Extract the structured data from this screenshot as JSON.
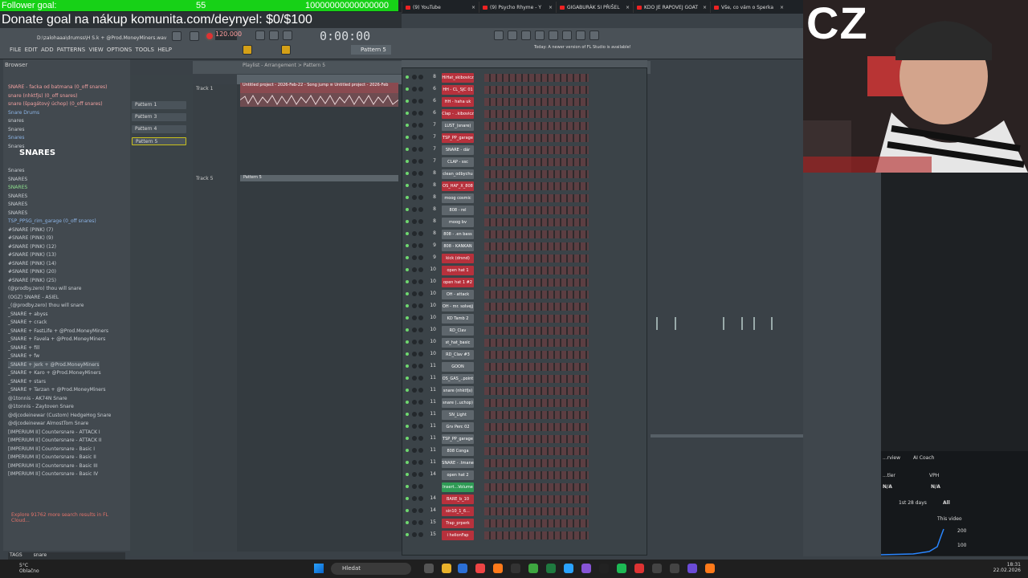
{
  "stream": {
    "follower_goal": "Follower goal:",
    "follower_count": "55",
    "follower_target": "10000000000000000",
    "donate": "Donate goal na nákup komunita.com/deynyel: $0/$100",
    "logo": "CZ"
  },
  "browser_tabs": [
    {
      "title": "(9) YouTube"
    },
    {
      "title": "(9) Psycho Rhyme - Y"
    },
    {
      "title": "GIGABURÁK SI PŘIŠEL"
    },
    {
      "title": "KDO JE RAPOVEJ GOAT"
    },
    {
      "title": "Vše, co vám o Sperka"
    }
  ],
  "daw": {
    "path": "D:\\zalohaaa\\drumss\\H S.k + @Prod.MoneyMiners.wav",
    "menu": "FILE EDIT ADD PATTERNS VIEW OPTIONS TOOLS HELP",
    "tempo": "120.000",
    "time": "0:00:00",
    "pattern_selector": "Pattern 5",
    "news": "Today: A newer version of FL Studio is available!",
    "playlist_title": "Playlist - Arrangement > Pattern 5",
    "browser_title": "Browser",
    "browser_items": [
      {
        "label": "SNARE - facka od batmana  (0_off snares)",
        "style": "red"
      },
      {
        "label": "snare (nhktfjs)  (0_off snares)",
        "style": "red"
      },
      {
        "label": "snare (špagátový úchop)  (0_off snares)",
        "style": "red"
      },
      {
        "label": "Snare Drums",
        "style": "blu"
      },
      {
        "label": "snares",
        "style": ""
      },
      {
        "label": "Snares",
        "style": ""
      },
      {
        "label": "Snares",
        "style": "blu"
      },
      {
        "label": "Snares",
        "style": ""
      },
      {
        "label": "Snares",
        "style": ""
      },
      {
        "label": "SNARES",
        "style": ""
      },
      {
        "label": "SNARES",
        "style": "grn"
      },
      {
        "label": "SNARES",
        "style": ""
      },
      {
        "label": "SNARES",
        "style": ""
      },
      {
        "label": "SNARES",
        "style": ""
      },
      {
        "label": "TSP_PPSG_rim_garage  (0_off snares)",
        "style": "blu"
      },
      {
        "label": "#SNARE (PINK) (7)",
        "style": ""
      },
      {
        "label": "#SNARE (PINK) (9)",
        "style": ""
      },
      {
        "label": "#SNARE (PINK) (12)",
        "style": ""
      },
      {
        "label": "#SNARE (PINK) (13)",
        "style": ""
      },
      {
        "label": "#SNARE (PINK) (14)",
        "style": ""
      },
      {
        "label": "#SNARE (PINK) (20)",
        "style": ""
      },
      {
        "label": "#SNARE (PINK) (25)",
        "style": ""
      },
      {
        "label": "(@prodby.zero) thou will snare",
        "style": ""
      },
      {
        "label": "(OGZ) SNARE - ASIEL",
        "style": ""
      },
      {
        "label": "_(@prodby.zero) thou will snare",
        "style": ""
      },
      {
        "label": "_SNARE + abyss",
        "style": ""
      },
      {
        "label": "_SNARE + crack",
        "style": ""
      },
      {
        "label": "_SNARE + FastLife + @Prod.MoneyMiners",
        "style": ""
      },
      {
        "label": "_SNARE + Favela + @Prod.MoneyMiners",
        "style": ""
      },
      {
        "label": "_SNARE + fill",
        "style": ""
      },
      {
        "label": "_SNARE + fw",
        "style": ""
      },
      {
        "label": "_SNARE + Jerk + @Prod.MoneyMiners",
        "style": "sel"
      },
      {
        "label": "_SNARE + Karo + @Prod.MoneyMiners",
        "style": ""
      },
      {
        "label": "_SNARE + stars",
        "style": ""
      },
      {
        "label": "_SNARE + Tarzan + @Prod.MoneyMiners",
        "style": ""
      },
      {
        "label": "@1tonnis - AK74N Snare",
        "style": ""
      },
      {
        "label": "@1tonnis - Zaytoven Snare",
        "style": ""
      },
      {
        "label": "@djcodeinewar (Custom) HedgeHog Snare",
        "style": ""
      },
      {
        "label": "@djcodeinewar AlmostTom Snare",
        "style": ""
      },
      {
        "label": "[IMPERIUM II] Countersnare - ATTACK I",
        "style": ""
      },
      {
        "label": "[IMPERIUM II] Countersnare - ATTACK II",
        "style": ""
      },
      {
        "label": "[IMPERIUM II] Countersnare - Basic I",
        "style": ""
      },
      {
        "label": "[IMPERIUM II] Countersnare - Basic II",
        "style": ""
      },
      {
        "label": "[IMPERIUM II] Countersnare - Basic III",
        "style": ""
      },
      {
        "label": "[IMPERIUM II] Countersnare - Basic IV",
        "style": ""
      }
    ],
    "snares_heading": "SNARES",
    "explore": "Explore 91762 more search results in FL Cloud...",
    "search_tag": "TAGS",
    "search_value": "snare",
    "patterns": [
      "Pattern 1",
      "Pattern 3",
      "Pattern 4",
      "Pattern 5"
    ],
    "tracks": [
      "Track 1",
      "Track 5"
    ],
    "clip_title": "Untitled project - 2026-Feb-22 - Song jump  ≡ Untitled project - 2026-Feb",
    "clip2_title": "Pattern 5",
    "channels": [
      {
        "mix": "8",
        "name": "HiHat_skibovicz",
        "color": "r"
      },
      {
        "mix": "6",
        "name": "HH - CL_SJC 01",
        "color": "r"
      },
      {
        "mix": "6",
        "name": "HH - haha uk",
        "color": "r"
      },
      {
        "mix": "6",
        "name": "Clap - ..kibovicz",
        "color": "r"
      },
      {
        "mix": "7",
        "name": "LUST_(snare)",
        "color": ""
      },
      {
        "mix": "7",
        "name": "TSP_PP_garage",
        "color": "r"
      },
      {
        "mix": "7",
        "name": "SNARE - dár",
        "color": ""
      },
      {
        "mix": "7",
        "name": "CLAP - ssc",
        "color": ""
      },
      {
        "mix": "8",
        "name": "clean_odbychu",
        "color": ""
      },
      {
        "mix": "8",
        "name": "OS_HAF_X_808",
        "color": "r"
      },
      {
        "mix": "8",
        "name": "moog cosmic",
        "color": ""
      },
      {
        "mix": "8",
        "name": "808 - rel",
        "color": ""
      },
      {
        "mix": "8",
        "name": "moog bv",
        "color": ""
      },
      {
        "mix": "8",
        "name": "808 - .en bass",
        "color": ""
      },
      {
        "mix": "9",
        "name": "808 - KANKAN",
        "color": ""
      },
      {
        "mix": "9",
        "name": "kick (drsnd)",
        "color": "r"
      },
      {
        "mix": "10",
        "name": "open hat 1",
        "color": "r"
      },
      {
        "mix": "10",
        "name": "open hat 1 #2",
        "color": "r"
      },
      {
        "mix": "10",
        "name": "OH - attack",
        "color": ""
      },
      {
        "mix": "10",
        "name": "OH - mr. solvejj",
        "color": ""
      },
      {
        "mix": "10",
        "name": "KD Tamb 2",
        "color": ""
      },
      {
        "mix": "10",
        "name": "RD_Clav",
        "color": ""
      },
      {
        "mix": "10",
        "name": "st_hat_basic",
        "color": ""
      },
      {
        "mix": "10",
        "name": "RD_Clav #3",
        "color": ""
      },
      {
        "mix": "11",
        "name": "GOON",
        "color": ""
      },
      {
        "mix": "11",
        "name": "OS_GAS_..point",
        "color": ""
      },
      {
        "mix": "11",
        "name": "snare (nhktfjs)",
        "color": ""
      },
      {
        "mix": "11",
        "name": "snare (..uchop)",
        "color": ""
      },
      {
        "mix": "11",
        "name": "SN_Light",
        "color": ""
      },
      {
        "mix": "11",
        "name": "Grv Perc 02",
        "color": ""
      },
      {
        "mix": "11",
        "name": "TSP_PP_garage",
        "color": ""
      },
      {
        "mix": "11",
        "name": "808 Conga",
        "color": ""
      },
      {
        "mix": "11",
        "name": "SNARE - .tmane",
        "color": ""
      },
      {
        "mix": "14",
        "name": "open hat 2",
        "color": ""
      },
      {
        "mix": "",
        "name": "Insert...Volume",
        "color": "g"
      },
      {
        "mix": "14",
        "name": "BARE_b_10",
        "color": "r"
      },
      {
        "mix": "14",
        "name": "sin10_1_6...",
        "color": "r"
      },
      {
        "mix": "15",
        "name": "Trap_prperk",
        "color": "r"
      },
      {
        "mix": "15",
        "name": "i helionFap",
        "color": "r"
      }
    ]
  },
  "coach": {
    "tab1": "...rview",
    "tab2": "AI Coach",
    "col1": "...tler",
    "col2": "VPH",
    "val1": "N/A",
    "val2": "N/A",
    "range": "1st 28 days",
    "all": "All",
    "legend": "This video",
    "y1": "200",
    "y2": "100"
  },
  "taskbar": {
    "temp": "5°C",
    "weather": "Oblačno",
    "search": "Hledat",
    "time": "18:31",
    "date": "22.02.2026"
  }
}
